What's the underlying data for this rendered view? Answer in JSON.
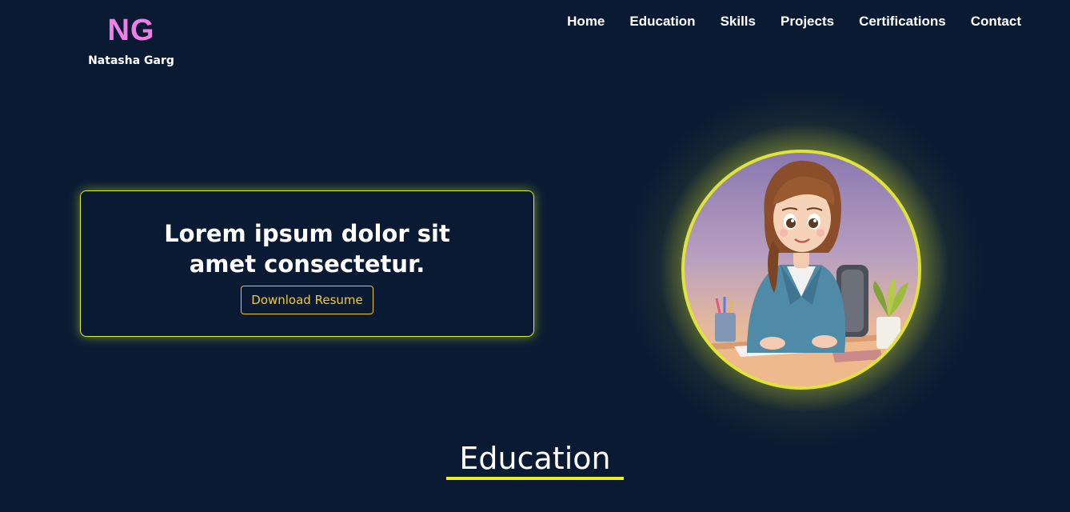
{
  "brand": {
    "initials": "NG",
    "name": "Natasha Garg"
  },
  "nav": {
    "items": [
      "Home",
      "Education",
      "Skills",
      "Projects",
      "Certifications",
      "Contact"
    ]
  },
  "hero": {
    "headline": "Lorem ipsum dolor sit amet consectetur.",
    "button_label": "Download Resume"
  },
  "sections": {
    "education_heading": "Education"
  },
  "colors": {
    "background": "#0b1a33",
    "logo_accent": "#ee7fe9",
    "glow": "#dfe33a",
    "button_accent": "#f0c425",
    "heading_underline": "#e9f21d"
  },
  "icons": {
    "avatar": "cartoon-woman-at-desk-illustration"
  }
}
